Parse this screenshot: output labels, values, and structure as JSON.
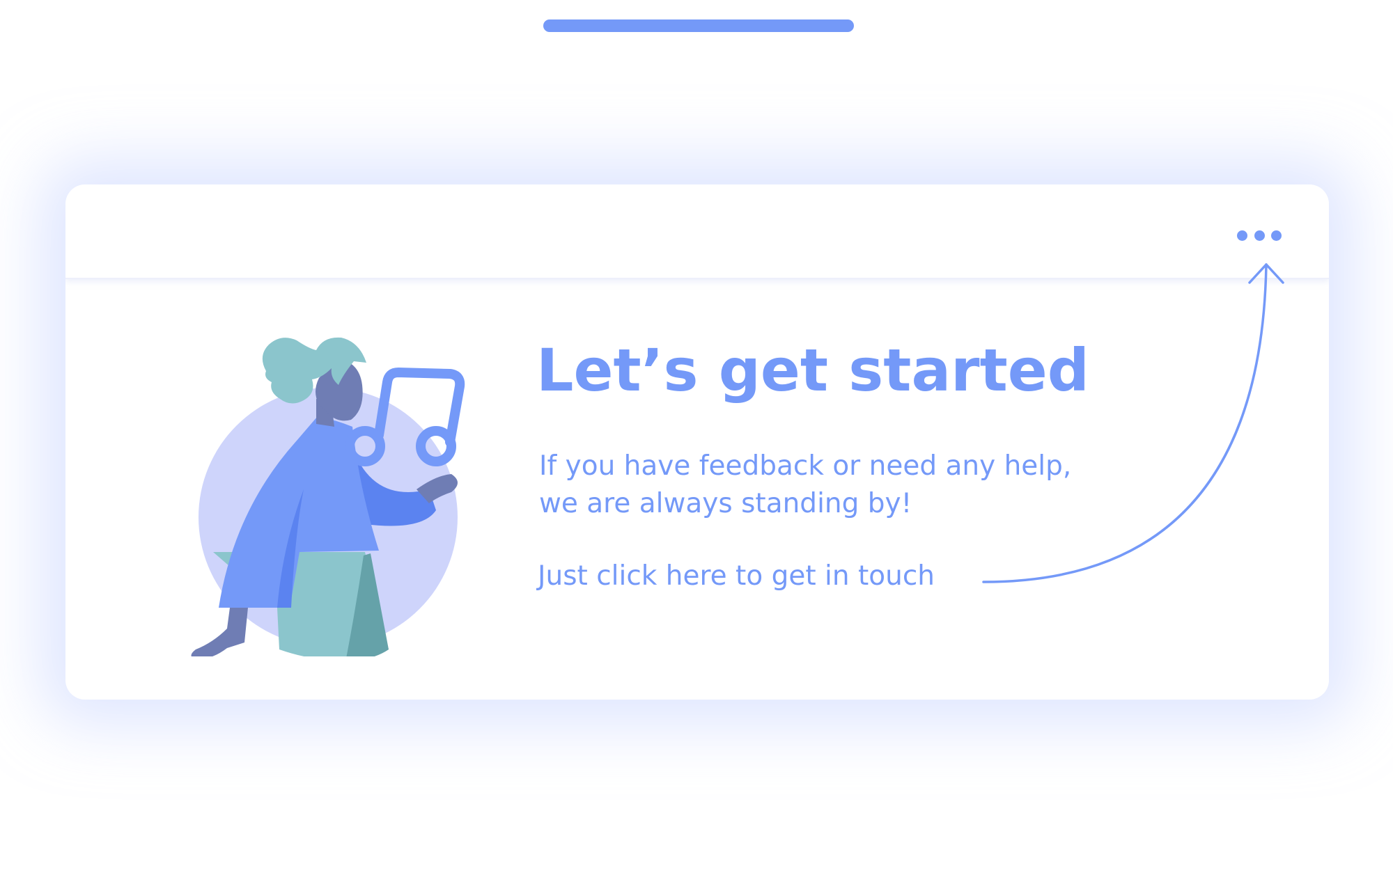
{
  "top_handle": {
    "color": "#7499f8"
  },
  "card": {
    "header": {
      "more_icon": "more-dots-icon"
    },
    "illustration": {
      "icons": [
        "person-illustration-icon",
        "music-note-icon"
      ]
    },
    "title": "Let’s get started",
    "subtitle": "If you have feedback or need any help,\nwe are always standing by!",
    "contact_link": "Just click here to get in touch",
    "arrow_icon": "curved-arrow-up-icon"
  },
  "colors": {
    "accent": "#7499f8",
    "circle": "#ced4fb",
    "hair": "#8bc5cc",
    "skin": "#6f7db4",
    "skirt_dark": "#65a2a9"
  }
}
